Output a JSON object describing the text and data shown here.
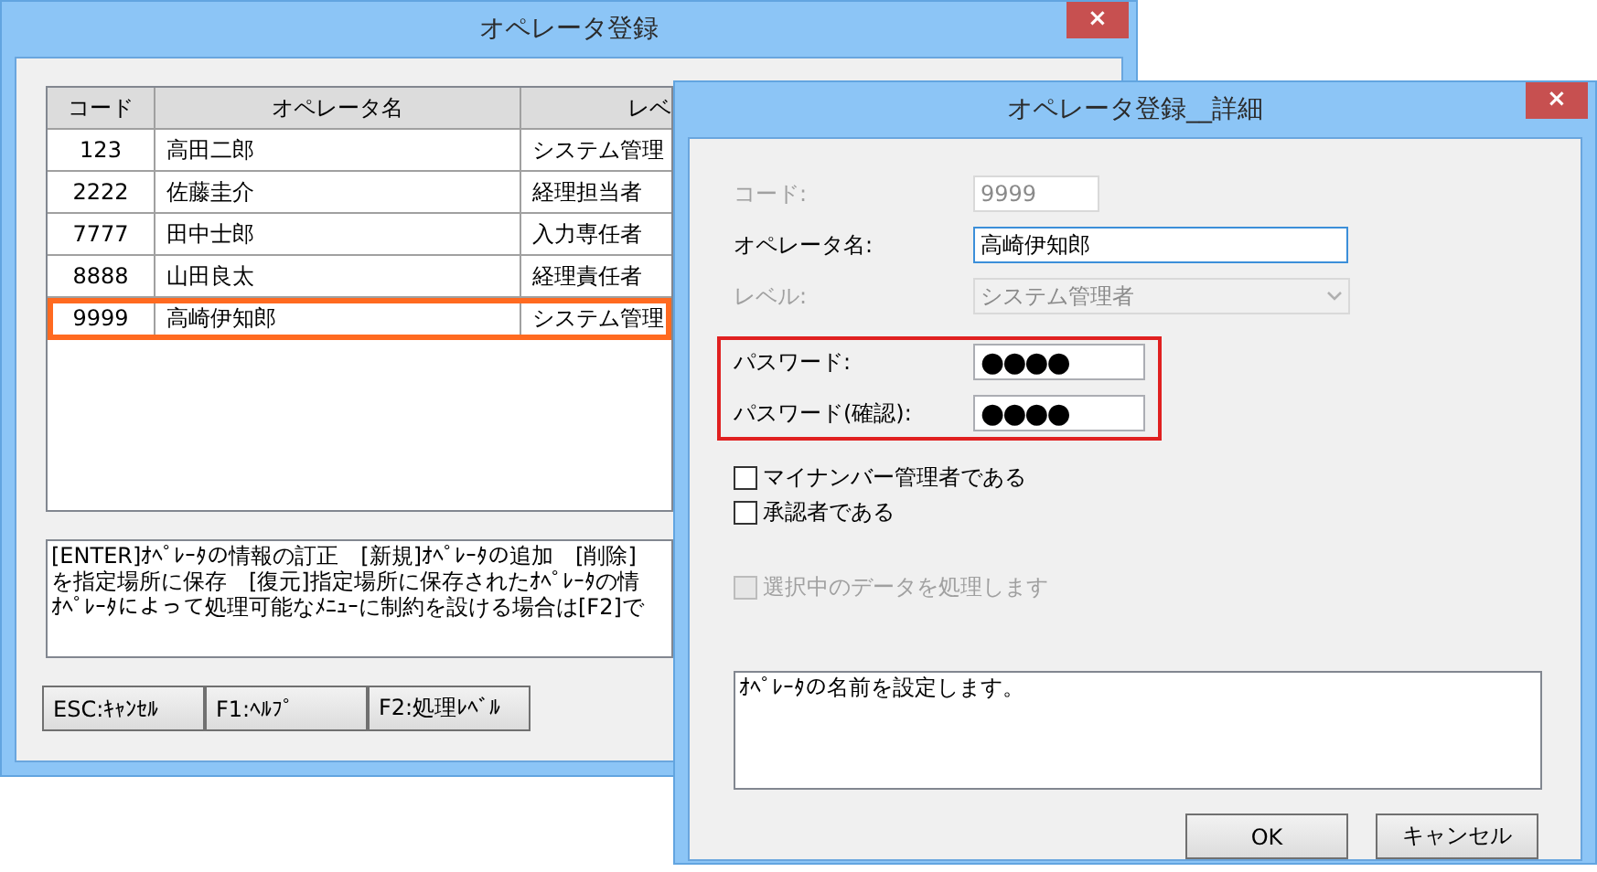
{
  "main_window": {
    "title": "オペレータ登録",
    "close": "×",
    "table": {
      "columns": [
        "コード",
        "オペレータ名",
        "レベ"
      ],
      "rows": [
        {
          "cells": [
            "123",
            "高田二郎",
            "システム管理"
          ],
          "selected": false
        },
        {
          "cells": [
            "2222",
            "佐藤圭介",
            "経理担当者"
          ],
          "selected": false
        },
        {
          "cells": [
            "7777",
            "田中士郎",
            "入力専任者"
          ],
          "selected": false
        },
        {
          "cells": [
            "8888",
            "山田良太",
            "経理責任者"
          ],
          "selected": false
        },
        {
          "cells": [
            "9999",
            "高崎伊知郎",
            "システム管理"
          ],
          "selected": true
        }
      ]
    },
    "help_text": [
      "[ENTER]ｵﾍﾟﾚｰﾀの情報の訂正　[新規]ｵﾍﾟﾚｰﾀの追加　[削除]",
      "を指定場所に保存　[復元]指定場所に保存されたｵﾍﾟﾚｰﾀの情",
      "ｵﾍﾟﾚｰﾀによって処理可能なﾒﾆｭｰに制約を設ける場合は[F2]で"
    ],
    "buttons": [
      "ESC:ｷｬﾝｾﾙ",
      "F1:ﾍﾙﾌﾟ",
      "F2:処理ﾚﾍﾞﾙ"
    ]
  },
  "detail_window": {
    "title": "オペレータ登録__詳細",
    "close": "×",
    "fields": [
      {
        "kind": "text",
        "label": "コード:",
        "value": "9999",
        "disabled": true,
        "focused": false,
        "highlighted": false
      },
      {
        "kind": "text",
        "label": "オペレータ名:",
        "value": "高崎伊知郎",
        "disabled": false,
        "focused": true,
        "highlighted": false
      },
      {
        "kind": "select",
        "label": "レベル:",
        "value": "システム管理者",
        "disabled": true,
        "focused": false,
        "highlighted": false
      },
      {
        "kind": "password",
        "label": "パスワード:",
        "value": "●●●●",
        "disabled": false,
        "focused": false,
        "highlighted": true
      },
      {
        "kind": "password",
        "label": "パスワード(確認):",
        "value": "●●●●",
        "disabled": false,
        "focused": false,
        "highlighted": true
      }
    ],
    "checkboxes": [
      {
        "label": "マイナンバー管理者である",
        "checked": false,
        "disabled": false
      },
      {
        "label": "承認者である",
        "checked": false,
        "disabled": false
      },
      {
        "label": "選択中のデータを処理します",
        "checked": false,
        "disabled": true
      }
    ],
    "description": "ｵﾍﾟﾚｰﾀの名前を設定します。",
    "buttons": [
      "OK",
      "キャンセル"
    ]
  }
}
